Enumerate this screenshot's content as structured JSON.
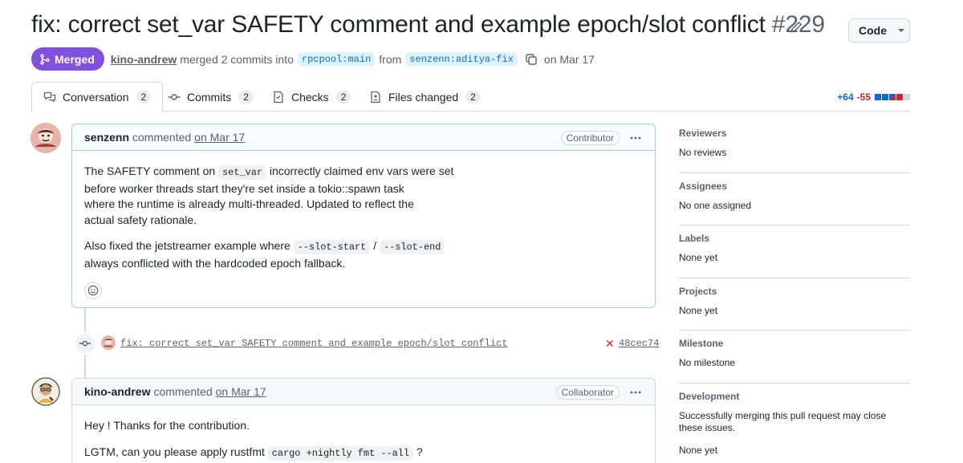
{
  "pr": {
    "title": "fix: correct set_var SAFETY comment and example epoch/slot conflict",
    "number": "#229",
    "state": "Merged",
    "author": "kino-andrew",
    "merge_text": "merged 2 commits into",
    "base_branch": "rpcpool:main",
    "from_text": "from",
    "head_branch": "senzenn:aditya-fix",
    "date_text": "on Mar 17"
  },
  "code_button": {
    "label": "Code"
  },
  "tabs": [
    {
      "label": "Conversation",
      "count": "2"
    },
    {
      "label": "Commits",
      "count": "2"
    },
    {
      "label": "Checks",
      "count": "2"
    },
    {
      "label": "Files changed",
      "count": "2"
    }
  ],
  "diffstat": {
    "additions": "+64",
    "deletions": "-55"
  },
  "comments": [
    {
      "author": "senzenn",
      "verb": "commented",
      "when": "on Mar 17",
      "role": "Contributor",
      "p1_a": "The SAFETY comment on",
      "p1_code": "set_var",
      "p1_b": "incorrectly claimed env vars were set",
      "p1_c": "before worker threads start they're set inside a tokio::spawn task",
      "p1_d": "where the runtime is already multi-threaded. Updated to reflect the",
      "p1_e": "actual safety rationale.",
      "p2_a": "Also fixed the jetstreamer example where",
      "p2_code1": "--slot-start",
      "p2_sep": "/",
      "p2_code2": "--slot-end",
      "p2_b": "always conflicted with the hardcoded epoch fallback."
    },
    {
      "author": "kino-andrew",
      "verb": "commented",
      "when": "on Mar 17",
      "role": "Collaborator",
      "p1": "Hey ! Thanks for the contribution.",
      "p2_a": "LGTM, can you please apply rustfmt",
      "p2_code": "cargo +nightly fmt --all",
      "p2_b": "?"
    }
  ],
  "commit": {
    "message": "fix: correct set_var SAFETY comment and example epoch/slot conflict",
    "sha": "48cec74"
  },
  "sidebar": {
    "reviewers": {
      "heading": "Reviewers",
      "value": "No reviews"
    },
    "assignees": {
      "heading": "Assignees",
      "value": "No one assigned"
    },
    "labels": {
      "heading": "Labels",
      "value": "None yet"
    },
    "projects": {
      "heading": "Projects",
      "value": "None yet"
    },
    "milestone": {
      "heading": "Milestone",
      "value": "No milestone"
    },
    "development": {
      "heading": "Development",
      "value": "Successfully merging this pull request may close these issues.",
      "sub": "None yet"
    }
  },
  "colors": {
    "merged": "#8250df",
    "link": "#0969da",
    "deletion": "#d1242f",
    "highlight_border": "#9ecbff"
  }
}
